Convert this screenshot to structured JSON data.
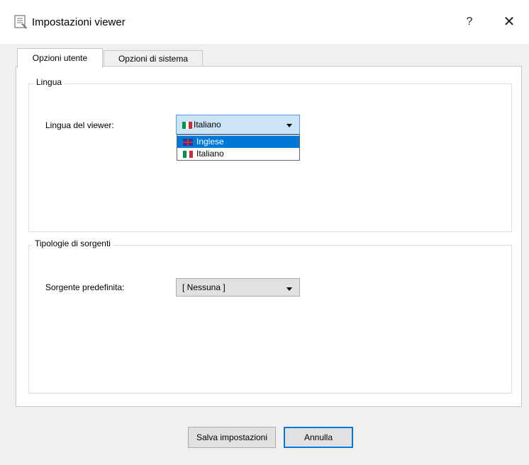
{
  "window": {
    "title": "Impostazioni viewer",
    "help": "?",
    "close": "✕"
  },
  "tabs": [
    {
      "label": "Opzioni utente"
    },
    {
      "label": "Opzioni di sistema"
    }
  ],
  "lingua": {
    "legend": "Lingua",
    "label": "Lingua del viewer:",
    "selected": "Italiano",
    "options": [
      {
        "label": "Inglese",
        "flag": "uk-flag-icon"
      },
      {
        "label": "Italiano",
        "flag": "italy-flag-icon"
      }
    ]
  },
  "sorgenti": {
    "legend": "Tipologie di sorgenti",
    "label": "Sorgente predefinita:",
    "selected": "[ Nessuna ]"
  },
  "buttons": {
    "save": "Salva impostazioni",
    "cancel": "Annulla"
  },
  "colors": {
    "accent": "#0078d7",
    "italy_green": "#009246",
    "italy_red": "#ce2b37"
  }
}
